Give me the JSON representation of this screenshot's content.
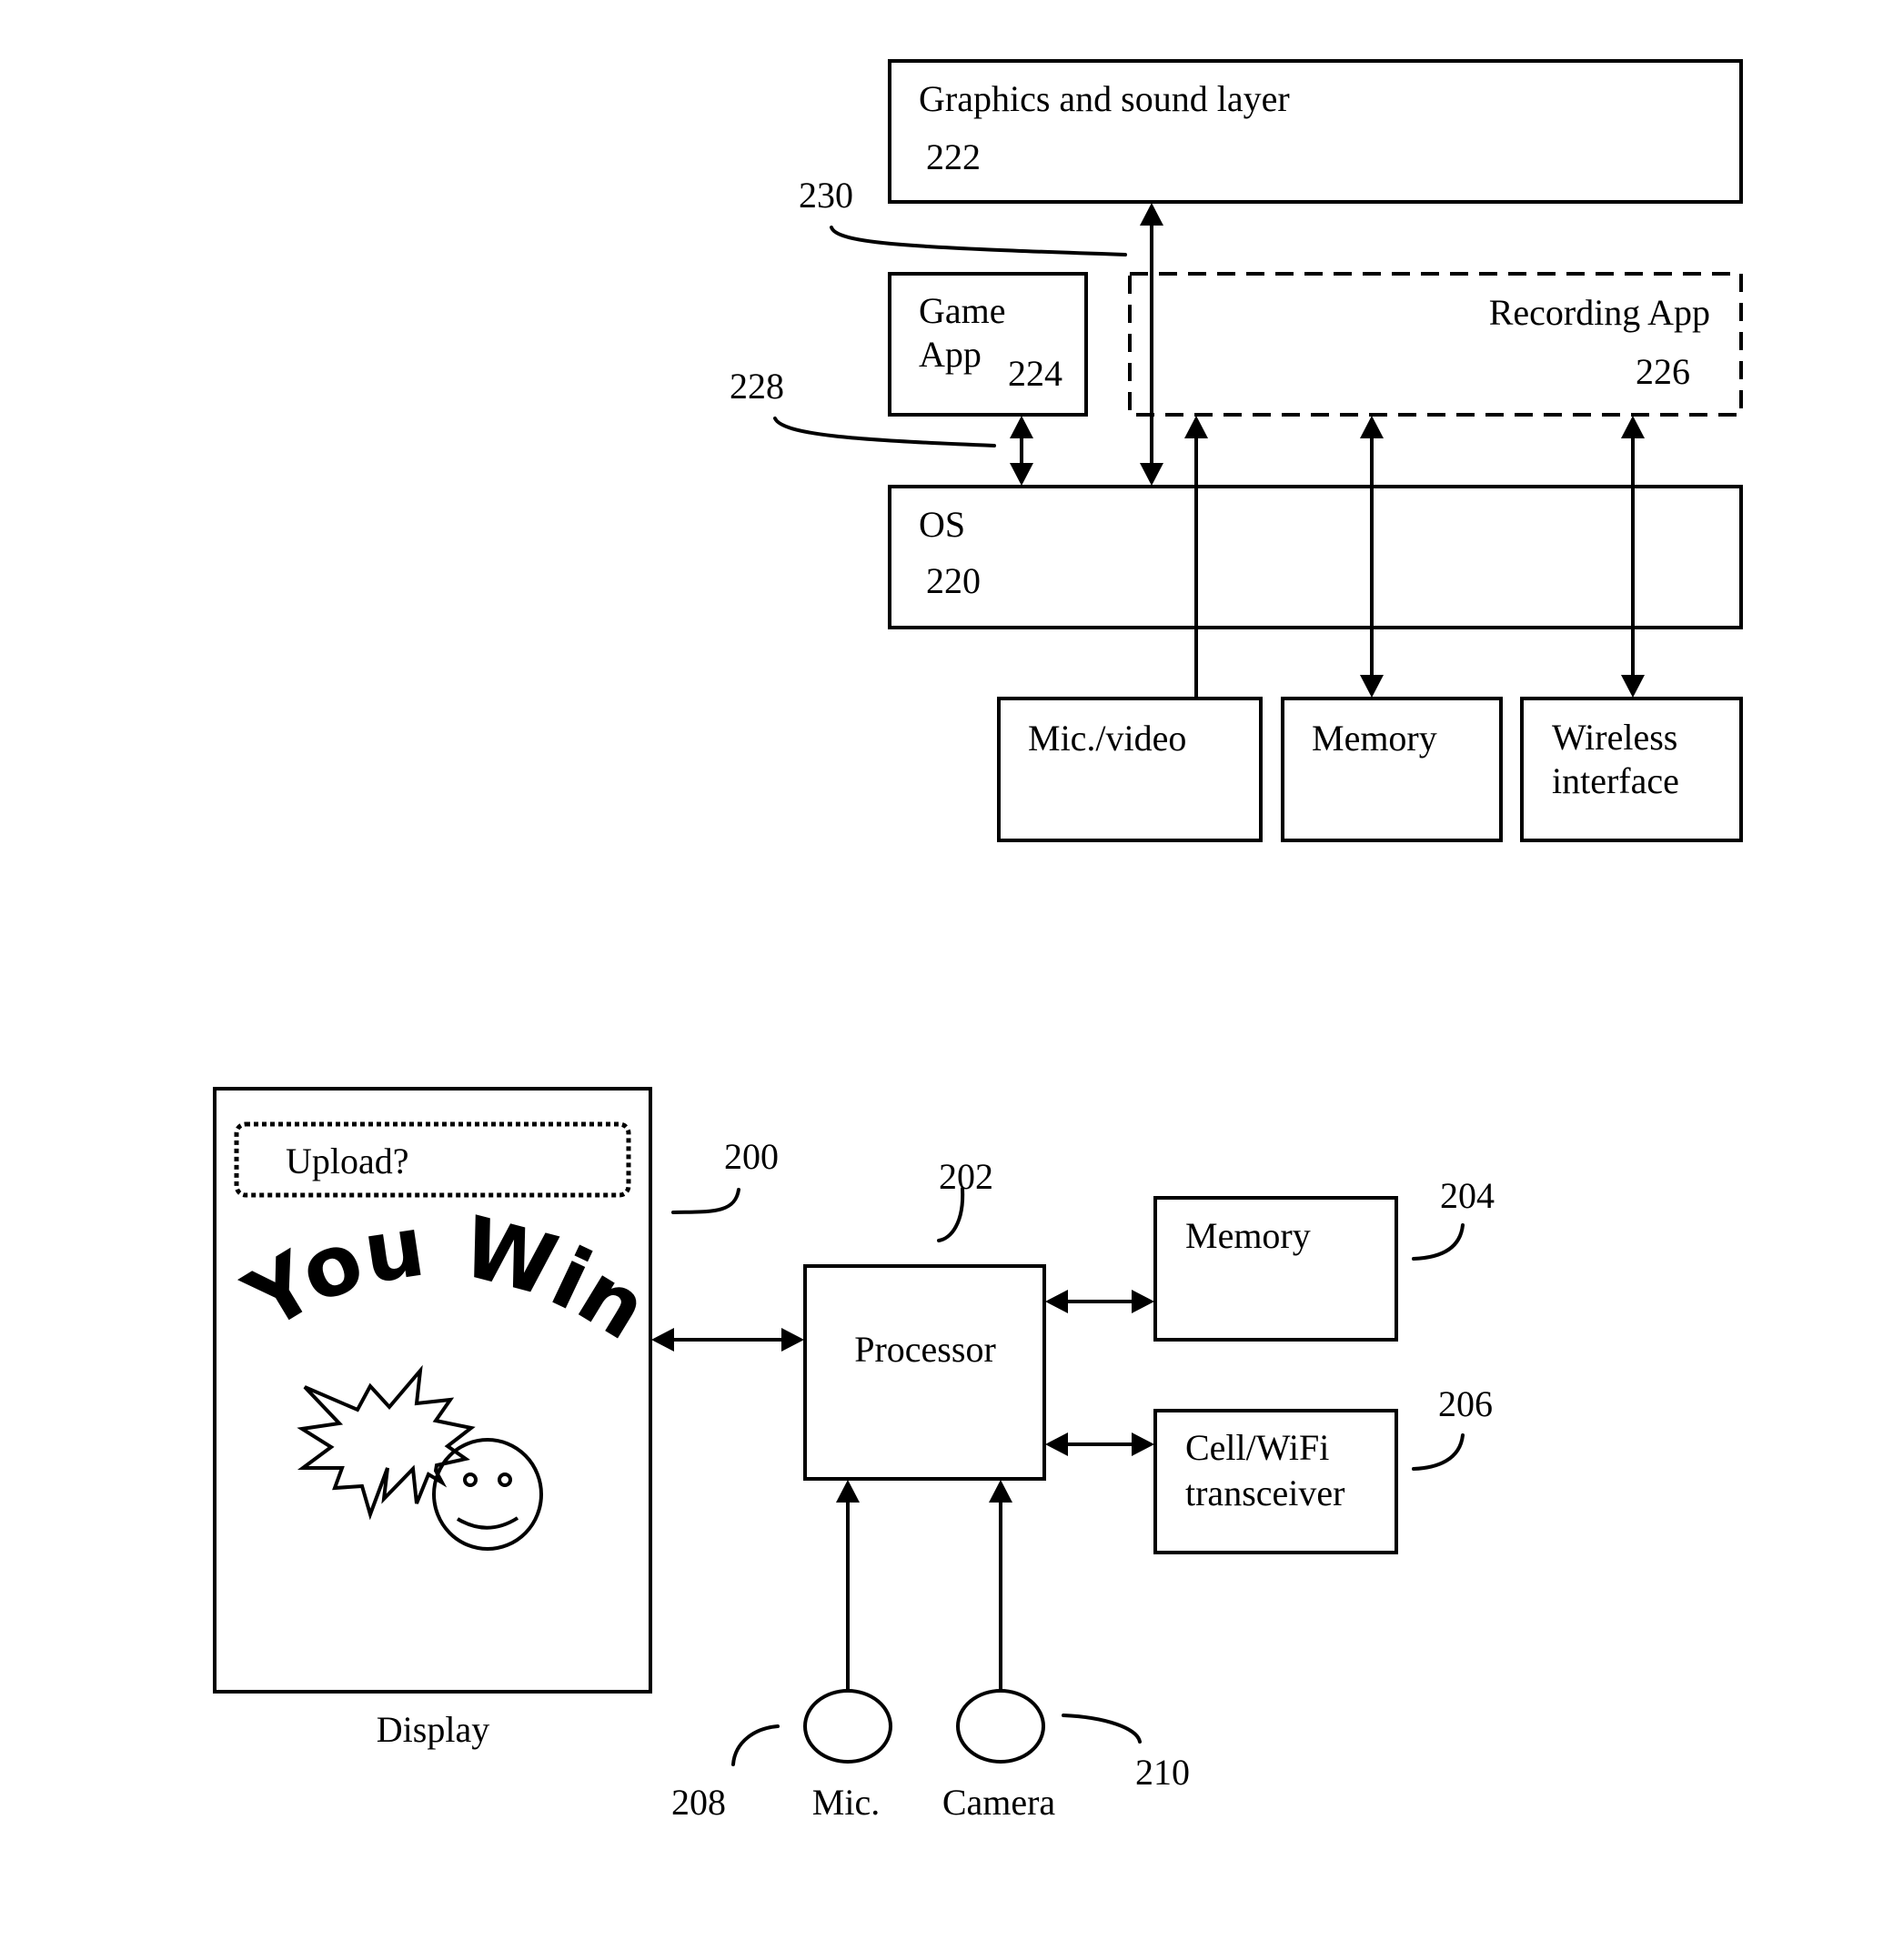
{
  "figure_top": {
    "boxes": {
      "graphics_layer": {
        "label": "Graphics and sound layer",
        "ref": "222"
      },
      "game_app": {
        "label_line1": "Game",
        "label_line2": "App",
        "ref": "224"
      },
      "recording_app": {
        "label": "Recording App",
        "ref": "226",
        "style": "dashed"
      },
      "os": {
        "label": "OS",
        "ref": "220"
      },
      "mic_video": {
        "label": "Mic./video"
      },
      "memory": {
        "label": "Memory"
      },
      "wireless": {
        "label_line1": "Wireless",
        "label_line2": "interface"
      }
    },
    "callouts": {
      "api_230": "230",
      "api_228": "228"
    },
    "connections": [
      {
        "from": "graphics_layer",
        "to": "os",
        "direction": "bidirectional",
        "ref": "230"
      },
      {
        "from": "game_app",
        "to": "os",
        "direction": "bidirectional",
        "ref": "228"
      },
      {
        "from": "mic_video",
        "to": "recording_app",
        "direction": "to"
      },
      {
        "from": "recording_app",
        "to": "memory",
        "direction": "bidirectional"
      },
      {
        "from": "recording_app",
        "to": "wireless",
        "direction": "bidirectional"
      }
    ]
  },
  "figure_bottom": {
    "display": {
      "caption": "Display",
      "ref": "200",
      "prompt": "Upload?",
      "banner": "You Win!!"
    },
    "processor": {
      "label": "Processor",
      "ref": "202"
    },
    "memory": {
      "label": "Memory",
      "ref": "204"
    },
    "transceiver": {
      "label_line1": "Cell/WiFi",
      "label_line2": "transceiver",
      "ref": "206"
    },
    "mic": {
      "label": "Mic.",
      "ref": "208"
    },
    "camera": {
      "label": "Camera",
      "ref": "210"
    },
    "connections": [
      {
        "from": "display",
        "to": "processor",
        "direction": "bidirectional"
      },
      {
        "from": "processor",
        "to": "memory",
        "direction": "bidirectional"
      },
      {
        "from": "processor",
        "to": "transceiver",
        "direction": "bidirectional"
      },
      {
        "from": "mic",
        "to": "processor",
        "direction": "to"
      },
      {
        "from": "camera",
        "to": "processor",
        "direction": "to"
      }
    ]
  }
}
